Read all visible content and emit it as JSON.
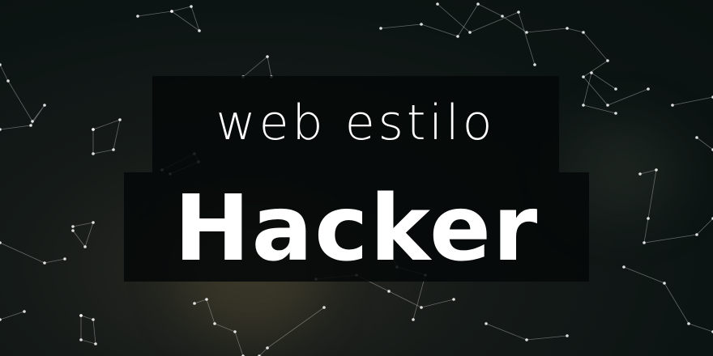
{
  "banner": {
    "line1": "web estilo",
    "line2": "Hacker"
  },
  "colors": {
    "background": "#0c1413",
    "text": "#ffffff",
    "box": "#050808"
  }
}
